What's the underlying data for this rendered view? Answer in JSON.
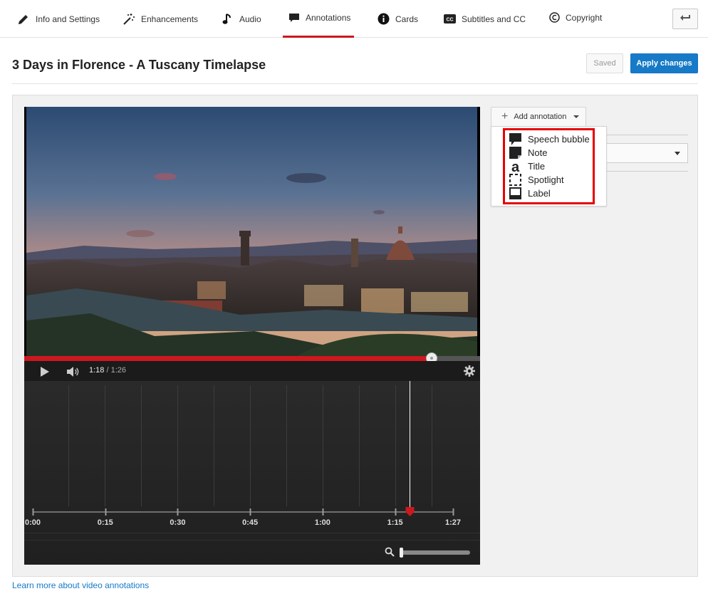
{
  "nav": {
    "tabs": [
      {
        "label": "Info and Settings",
        "icon": "pencil-icon"
      },
      {
        "label": "Enhancements",
        "icon": "magic-wand-icon"
      },
      {
        "label": "Audio",
        "icon": "music-note-icon"
      },
      {
        "label": "Annotations",
        "icon": "speech-bubble-icon",
        "active": true
      },
      {
        "label": "Cards",
        "icon": "info-icon"
      },
      {
        "label": "Subtitles and CC",
        "icon": "cc-icon"
      },
      {
        "label": "Copyright",
        "icon": "copyright-icon"
      }
    ],
    "back_icon": "return-arrow-icon"
  },
  "header": {
    "title": "3 Days in Florence - A Tuscany Timelapse",
    "saved_label": "Saved",
    "apply_label": "Apply changes"
  },
  "player": {
    "current_time": "1:18",
    "separator": " / ",
    "duration": "1:26",
    "progress_fraction": 0.893,
    "play_icon": "play-icon",
    "volume_icon": "volume-icon",
    "settings_icon": "gear-icon"
  },
  "timeline": {
    "ticks": [
      "0:00",
      "0:15",
      "0:30",
      "0:45",
      "1:00",
      "1:15",
      "1:27"
    ],
    "tick_seconds": [
      0,
      15,
      30,
      45,
      60,
      75,
      87
    ],
    "playhead_seconds": 78,
    "zoom_icon": "magnifier-icon",
    "zoom_fraction": 0.0
  },
  "annotations": {
    "add_label": "Add annotation",
    "menu_items": [
      {
        "label": "Speech bubble",
        "icon": "speech-bubble-icon"
      },
      {
        "label": "Note",
        "icon": "note-icon"
      },
      {
        "label": "Title",
        "icon": "title-icon"
      },
      {
        "label": "Spotlight",
        "icon": "spotlight-icon"
      },
      {
        "label": "Label",
        "icon": "label-icon"
      }
    ]
  },
  "footer": {
    "learn_more": "Learn more about video annotations"
  },
  "colors": {
    "accent_red": "#cc181e",
    "link_blue": "#167ac6",
    "highlight_red": "#e60000"
  }
}
